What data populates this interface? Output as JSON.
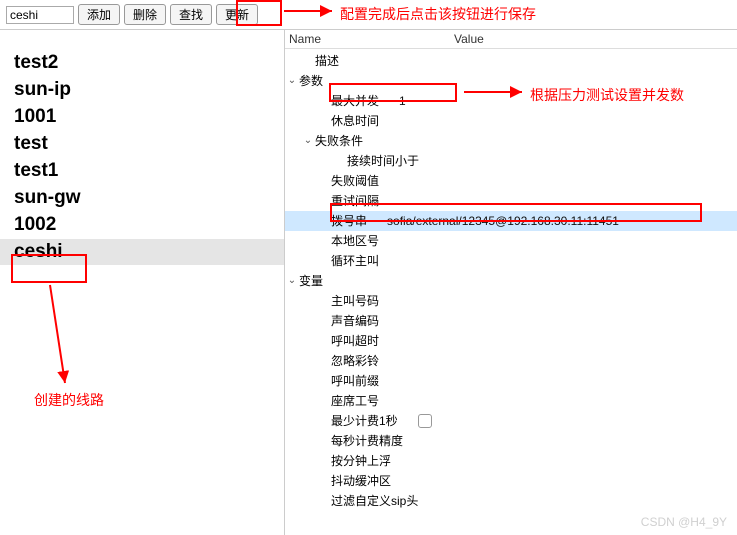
{
  "toolbar": {
    "search_value": "ceshi",
    "add_label": "添加",
    "delete_label": "删除",
    "find_label": "查找",
    "update_label": "更新"
  },
  "lines": [
    {
      "name": "test2",
      "selected": false
    },
    {
      "name": "sun-ip",
      "selected": false
    },
    {
      "name": "1001",
      "selected": false
    },
    {
      "name": "test",
      "selected": false
    },
    {
      "name": "test1",
      "selected": false
    },
    {
      "name": "sun-gw",
      "selected": false
    },
    {
      "name": "1002",
      "selected": false
    },
    {
      "name": "ceshi",
      "selected": true
    }
  ],
  "tree": {
    "header_name": "Name",
    "header_value": "Value",
    "rows": [
      {
        "indent": 1,
        "toggle": "",
        "label": "描述",
        "value": ""
      },
      {
        "indent": 0,
        "toggle": "v",
        "label": "参数",
        "value": ""
      },
      {
        "indent": 2,
        "toggle": "",
        "label": "最大并发",
        "value": "1",
        "highlight": true
      },
      {
        "indent": 2,
        "toggle": "",
        "label": "休息时间",
        "value": ""
      },
      {
        "indent": 1,
        "toggle": "v",
        "label": "失败条件",
        "value": ""
      },
      {
        "indent": 3,
        "toggle": "",
        "label": "接续时间小于",
        "value": ""
      },
      {
        "indent": 2,
        "toggle": "",
        "label": "失败阈值",
        "value": ""
      },
      {
        "indent": 2,
        "toggle": "",
        "label": "重试间隔",
        "value": ""
      },
      {
        "indent": 2,
        "toggle": "",
        "label": "拨号串",
        "value": "sofia/external/12345@192.168.30.11:11451",
        "selected": true
      },
      {
        "indent": 2,
        "toggle": "",
        "label": "本地区号",
        "value": ""
      },
      {
        "indent": 2,
        "toggle": "",
        "label": "循环主叫",
        "value": ""
      },
      {
        "indent": 0,
        "toggle": "v",
        "label": "变量",
        "value": ""
      },
      {
        "indent": 2,
        "toggle": "",
        "label": "主叫号码",
        "value": ""
      },
      {
        "indent": 2,
        "toggle": "",
        "label": "声音编码",
        "value": ""
      },
      {
        "indent": 2,
        "toggle": "",
        "label": "呼叫超时",
        "value": ""
      },
      {
        "indent": 2,
        "toggle": "",
        "label": "忽略彩铃",
        "value": ""
      },
      {
        "indent": 2,
        "toggle": "",
        "label": "呼叫前缀",
        "value": ""
      },
      {
        "indent": 2,
        "toggle": "",
        "label": "座席工号",
        "value": ""
      },
      {
        "indent": 2,
        "toggle": "",
        "label": "最少计费1秒",
        "value": "",
        "checkbox": true
      },
      {
        "indent": 2,
        "toggle": "",
        "label": "每秒计费精度",
        "value": ""
      },
      {
        "indent": 2,
        "toggle": "",
        "label": "按分钟上浮",
        "value": ""
      },
      {
        "indent": 2,
        "toggle": "",
        "label": "抖动缓冲区",
        "value": ""
      },
      {
        "indent": 2,
        "toggle": "",
        "label": "过滤自定义sip头",
        "value": ""
      }
    ]
  },
  "annotations": {
    "update_note": "配置完成后点击该按钮进行保存",
    "concurrency_note": "根据压力测试设置并发数",
    "created_line_note": "创建的线路"
  },
  "watermark": "CSDN @H4_9Y"
}
